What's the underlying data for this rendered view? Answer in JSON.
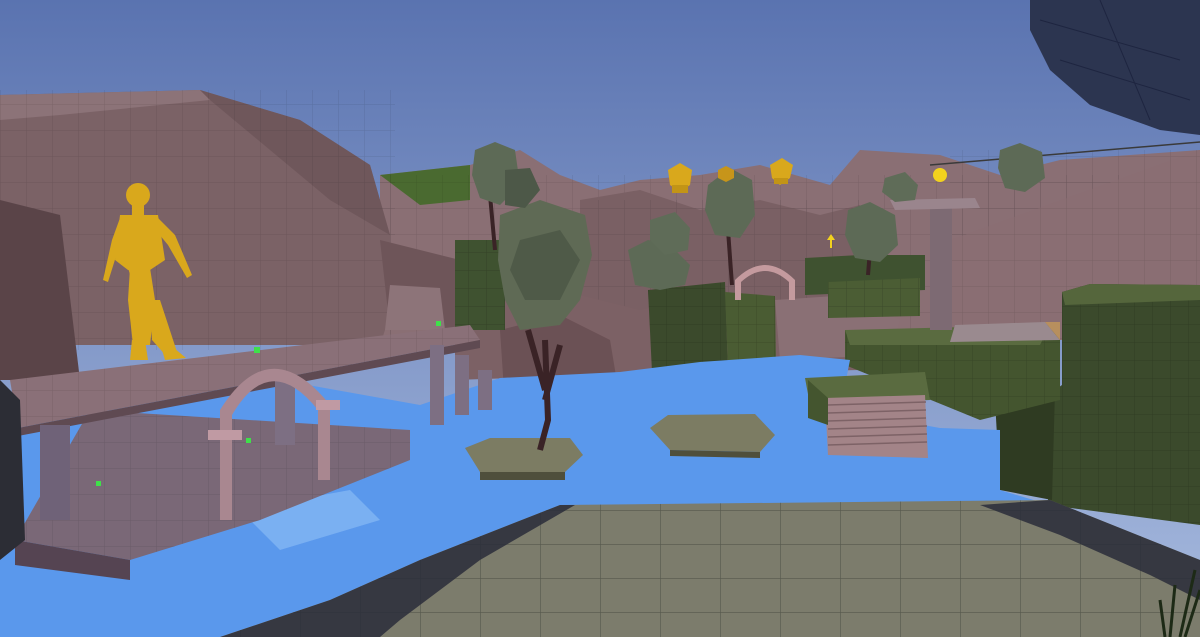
{
  "scene": {
    "kind": "3D game level viewport (no HUD text)",
    "colors": {
      "sky_top": "#5a73b0",
      "sky_bottom": "#9fb3d9",
      "cliff": "#7b6266",
      "cliff_dark": "#5a4448",
      "cliff_light": "#9a8085",
      "water": "#5a98ec",
      "water_light": "#7bb3f5",
      "hedge": "#3b4a2c",
      "hedge_light": "#4c5d36",
      "tree_foliage": "#5f6a55",
      "tree_trunk": "#3a2326",
      "floor": "#7c7c6c",
      "floor_shadow": "#2a2d3a",
      "statue": "#d9a81c",
      "pickup": "#3fe04a",
      "bridge": "#8a7078",
      "rock_overhang": "#2c3550"
    },
    "objects": [
      "golden-statue",
      "golden-bust-1",
      "golden-bust-2",
      "golden-bust-3",
      "yellow-orb",
      "yellow-arrow-marker",
      "stone-bridge",
      "stone-arch",
      "far-arch",
      "small-island-with-tree",
      "stepping-stone",
      "stone-stairs",
      "green-pickup-markers",
      "tiled-floor-foreground",
      "hedge-blocks",
      "low-poly-trees",
      "overhang-rock",
      "rope-line",
      "pillar-platform"
    ]
  }
}
